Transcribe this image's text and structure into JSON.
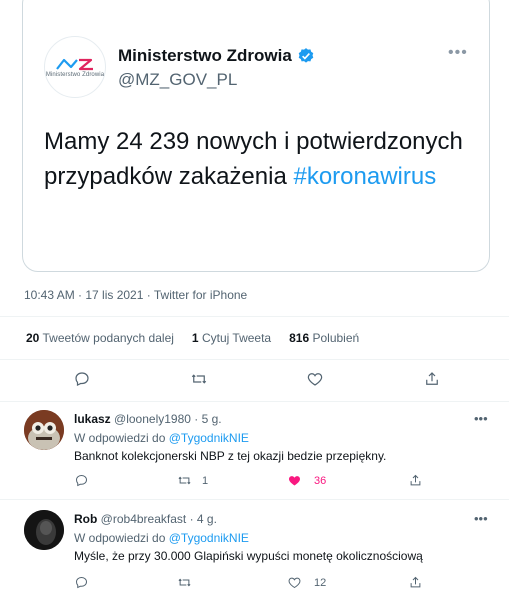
{
  "quoted": {
    "name": "Ministerstwo Zdrowia",
    "handle": "@MZ_GOV_PL",
    "logo_caption": "Ministerstwo Zdrowia",
    "text_main": "Mamy 24 239 nowych i potwierdzonych przypadków zakażenia ",
    "hashtag": "#koronawirus"
  },
  "tweet_meta": "10:43 AM · 17 lis 2021 · Twitter for iPhone",
  "stats": {
    "retweets_count": "20",
    "retweets_label": "Tweetów podanych dalej",
    "quotes_count": "1",
    "quotes_label": "Cytuj Tweeta",
    "likes_count": "816",
    "likes_label": "Polubień"
  },
  "replies": [
    {
      "name": "lukasz",
      "handle": "@loonely1980",
      "time": "· 5 g.",
      "reply_prefix": "W odpowiedzi do ",
      "reply_to": "@TygodnikNIE",
      "text": "Banknot kolekcjonerski NBP z tej okazji bedzie przepiękny.",
      "retweets": "1",
      "likes": "36",
      "liked": true
    },
    {
      "name": "Rob",
      "handle": "@rob4breakfast",
      "time": "· 4 g.",
      "reply_prefix": "W odpowiedzi do ",
      "reply_to": "@TygodnikNIE",
      "text": "Myśle, że przy 30.000 Glapiński wypuści monetę okolicznościową",
      "retweets": "",
      "likes": "12",
      "liked": false
    }
  ],
  "colors": {
    "accent": "#1d9bf0",
    "like": "#f91880",
    "muted": "#536471"
  },
  "icons": [
    "verified-badge-icon",
    "more-icon",
    "reply-icon",
    "retweet-icon",
    "like-icon",
    "share-icon"
  ]
}
